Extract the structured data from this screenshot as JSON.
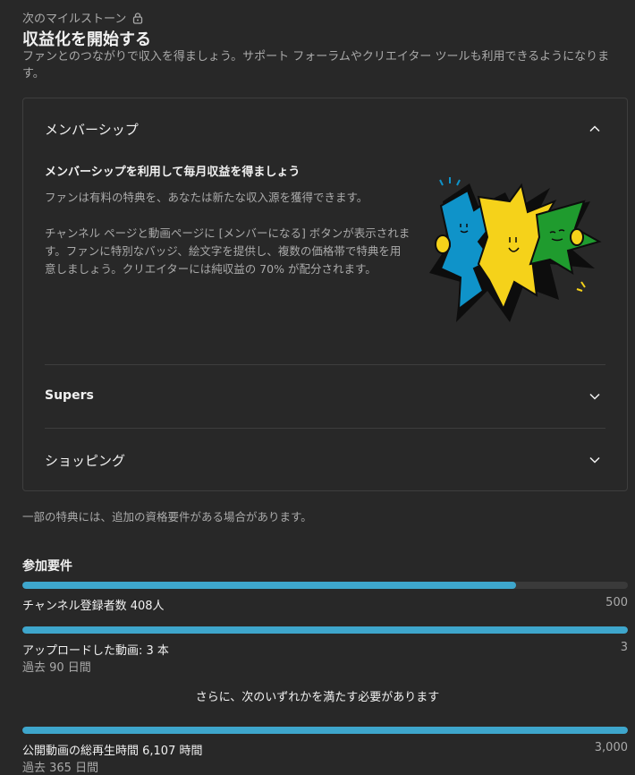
{
  "milestone": {
    "label": "次のマイルストーン",
    "title": "収益化を開始する",
    "subtitle": "ファンとのつながりで収入を得ましょう。サポート フォーラムやクリエイター ツールも利用できるようになります。"
  },
  "accordion": {
    "membership": {
      "header": "メンバーシップ",
      "heading": "メンバーシップを利用して毎月収益を得ましょう",
      "desc1": "ファンは有料の特典を、あなたは新たな収入源を獲得できます。",
      "desc2": "チャンネル ページと動画ページに [メンバーになる] ボタンが表示されます。ファンに特別なバッジ、絵文字を提供し、複数の価格帯で特典を用意しましょう。クリエイターには純収益の 70% が配分されます。"
    },
    "supers": {
      "header": "Supers"
    },
    "shopping": {
      "header": "ショッピング"
    }
  },
  "note": "一部の特典には、追加の資格要件がある場合があります。",
  "requirements": {
    "title": "参加要件",
    "subscribers": {
      "label": "チャンネル登録者数 408人",
      "target": "500",
      "progress": 0.816
    },
    "uploads": {
      "label": "アップロードした動画: 3 本",
      "target": "3",
      "period": "過去 90 日間",
      "progress": 1.0
    },
    "either_note": "さらに、次のいずれかを満たす必要があります",
    "watch_hours": {
      "label": "公開動画の総再生時間 6,107 時間",
      "target": "3,000",
      "period": "過去 365 日間",
      "progress": 1.0
    }
  },
  "colors": {
    "background": "#282828",
    "accent": "#3ea6cc",
    "text_secondary": "#aaaaaa"
  }
}
